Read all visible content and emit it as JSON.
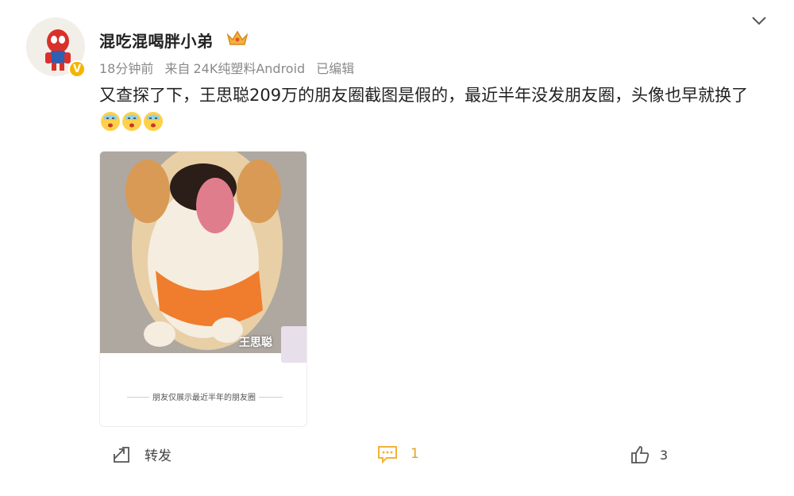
{
  "post": {
    "username": "混吃混喝胖小弟",
    "time": "18分钟前",
    "source_prefix": "来自",
    "source": "24K纯塑料Android",
    "edited": "已编辑",
    "text": "又查探了下，王思聪209万的朋友圈截图是假的，最近半年没发朋友圈，头像也早就换了",
    "emoji_count": 3,
    "emoji_icon": "emoji-face-icon"
  },
  "image_card": {
    "subject": "corgi-dog-photo",
    "label": "王思聪",
    "caption": "朋友仅展示最近半年的朋友圈"
  },
  "actions": {
    "repost_label": "转发",
    "comment_count": "1",
    "like_count": "3"
  },
  "colors": {
    "badge": "#f5b400",
    "comment_accent": "#f2b23a",
    "text": "#222222",
    "meta": "#8a8a8a"
  }
}
